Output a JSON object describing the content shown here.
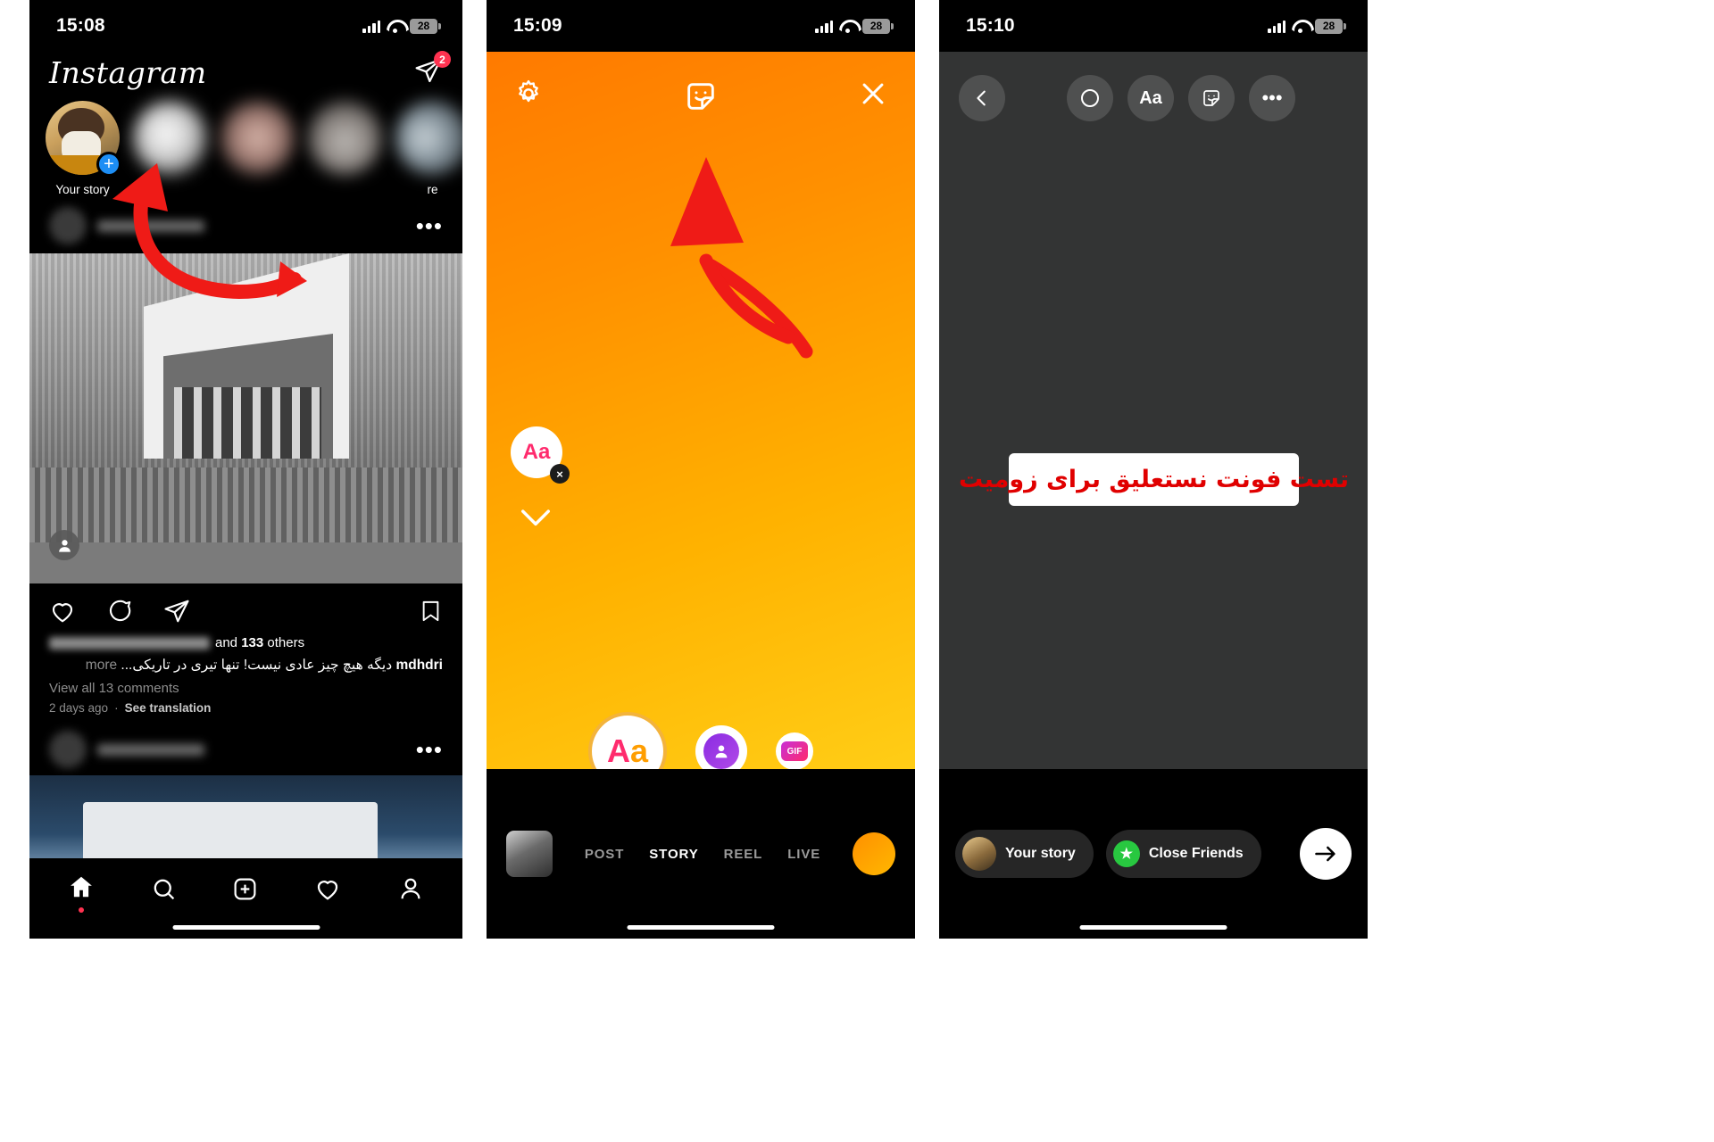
{
  "panels": [
    {
      "id": "instagram-feed",
      "status": {
        "time": "15:08",
        "battery": "28"
      },
      "header": {
        "logo": "Instagram",
        "dm_badge": "2"
      },
      "stories": [
        {
          "label": "Your story",
          "has_plus": true,
          "blurred": false
        },
        {
          "label": "",
          "has_plus": false,
          "blurred": true
        },
        {
          "label": "",
          "has_plus": false,
          "blurred": true
        },
        {
          "label": "",
          "has_plus": false,
          "blurred": true
        },
        {
          "label": "re",
          "has_plus": false,
          "blurred": true
        }
      ],
      "post": {
        "likes_suffix": "and 133 others",
        "likes_count": "133",
        "username": "mdhdri",
        "caption_line1": "دیگه هیچ چیز عادی نیست!",
        "caption_line2": "تنها تیری در تاریکی...",
        "more_label": "more",
        "comments_link": "View all 13 comments",
        "timestamp": "2 days ago",
        "separator": "·",
        "translate_link": "See translation"
      },
      "tabs": [
        "home-icon",
        "search-icon",
        "create-icon",
        "activity-icon",
        "profile-icon"
      ]
    },
    {
      "id": "story-camera",
      "status": {
        "time": "15:09",
        "battery": "28"
      },
      "top_icons": [
        "settings-gear-icon",
        "sticker-face-icon",
        "close-x-icon"
      ],
      "floating": {
        "aa_label": "Aa",
        "close_label": "×"
      },
      "create_buttons": [
        {
          "name": "text-create-button",
          "label": "Aa"
        },
        {
          "name": "avatar-create-button",
          "label": ""
        },
        {
          "name": "gif-create-button",
          "label": "GIF"
        }
      ],
      "modes": [
        {
          "label": "POST",
          "active": false
        },
        {
          "label": "STORY",
          "active": true
        },
        {
          "label": "REEL",
          "active": false
        },
        {
          "label": "LIVE",
          "active": false
        }
      ]
    },
    {
      "id": "story-editor",
      "status": {
        "time": "15:10",
        "battery": "28"
      },
      "tools": [
        "back-chevron-icon",
        "draw-circle-icon",
        "text-aa-icon",
        "sticker-face-icon",
        "more-dots-icon"
      ],
      "text_aa_label": "Aa",
      "canvas_text": "تست فونت نستعلیق برای زومیت",
      "bottom": {
        "your_story_label": "Your story",
        "close_friends_label": "Close Friends",
        "send_label": "send-arrow-icon"
      }
    }
  ],
  "colors": {
    "ig_blue": "#1d8ef5",
    "badge_red": "#ff3250",
    "annotation_red": "#ef1b17",
    "story_orange_start": "#ff7a00",
    "story_yellow_end": "#ffd21a",
    "nastaliq_red": "#e00000",
    "close_friends_green": "#28c840",
    "editor_bg": "#333434"
  }
}
